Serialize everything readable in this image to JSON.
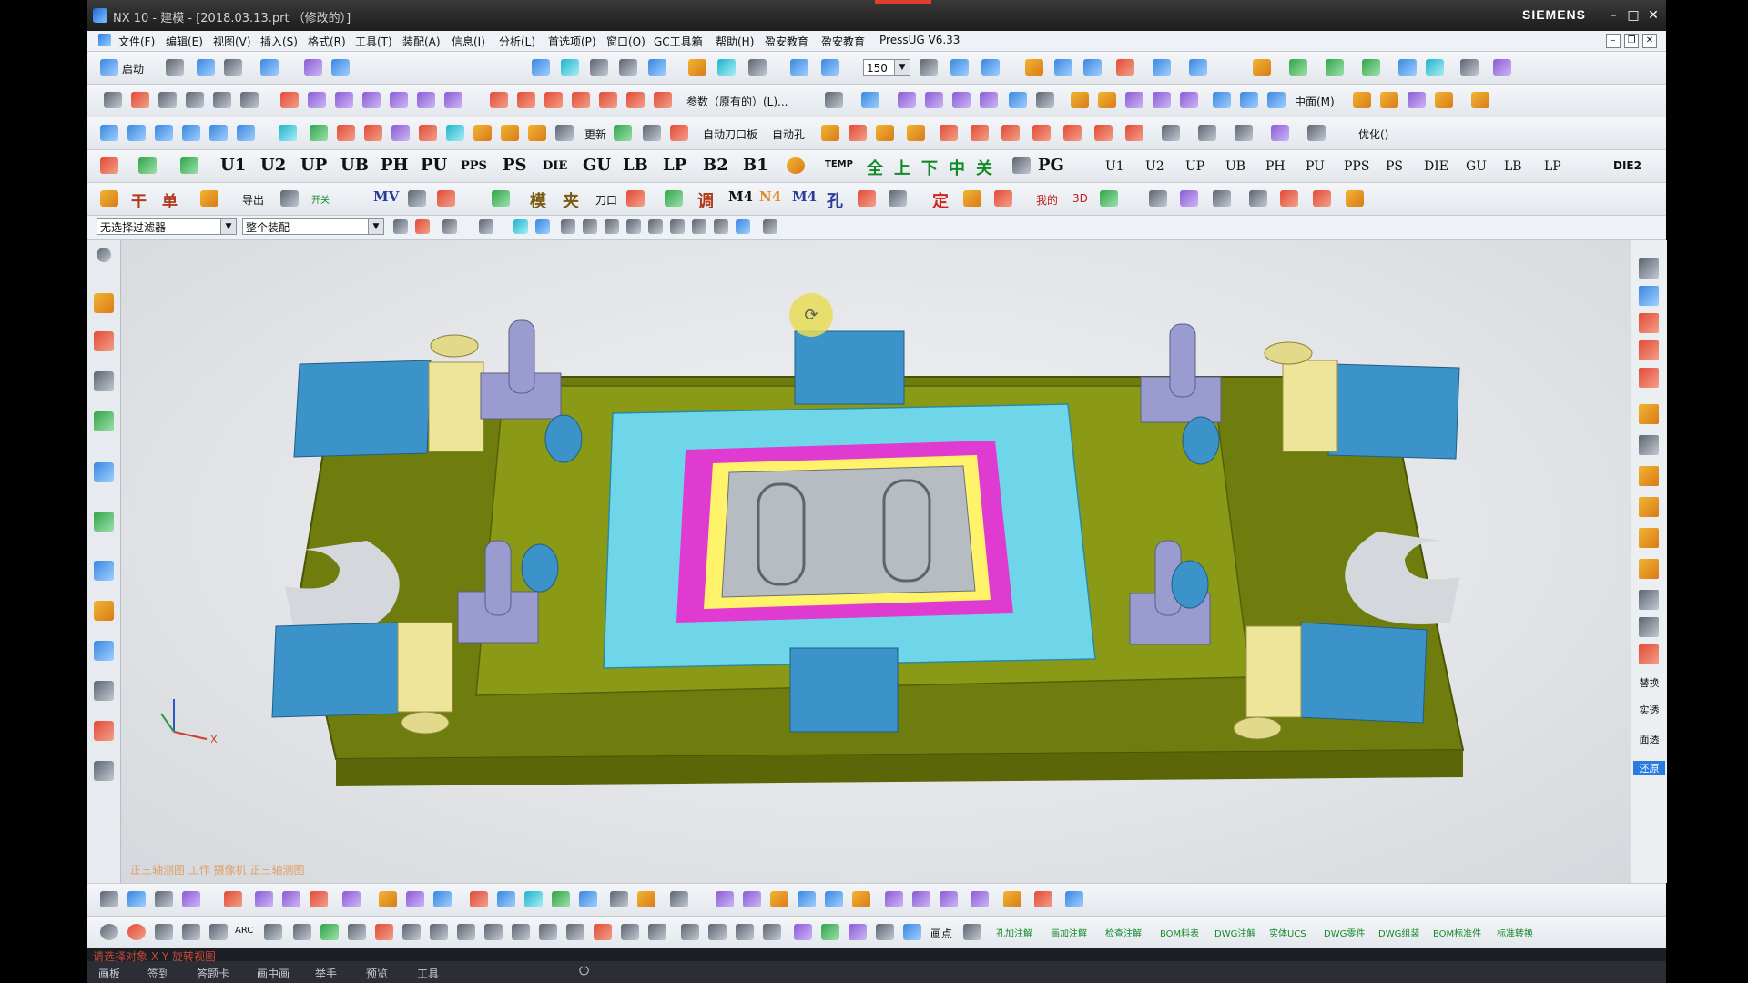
{
  "window": {
    "title": "NX 10 - 建模 - [2018.03.13.prt （修改的）]",
    "brand": "SIEMENS"
  },
  "menu": [
    "文件(F)",
    "编辑(E)",
    "视图(V)",
    "插入(S)",
    "格式(R)",
    "工具(T)",
    "装配(A)",
    "信息(I)",
    "分析(L)",
    "首选项(P)",
    "窗口(O)",
    "GC工具箱",
    "帮助(H)",
    "盈安教育",
    "盈安教育",
    "PressUG V6.33"
  ],
  "toolbar1": {
    "start_label": "启动",
    "zoom_value": "150"
  },
  "toolbar2": {
    "params_label": "参数（原有的）(L)...",
    "midplane_label": "中面(M)"
  },
  "toolbar3": {
    "auto_knife_label": "自动刀口板",
    "auto_hole_label": "自动孔",
    "optimize_label": "优化()",
    "update_label": "更新"
  },
  "toolbar4": {
    "left_codes": [
      "U1",
      "U2",
      "UP",
      "UB",
      "PH",
      "PU",
      "PPS",
      "PS",
      "DIE",
      "GU",
      "LB",
      "LP",
      "B2",
      "B1"
    ],
    "cjk_buttons": [
      "全",
      "上",
      "下",
      "中",
      "关"
    ],
    "right_codes": [
      "U1",
      "U2",
      "UP",
      "UB",
      "PH",
      "PU",
      "PPS",
      "PS",
      "DIE",
      "GU",
      "LB",
      "LP"
    ],
    "temp_label": "TEMP",
    "pg_label": "PG",
    "die2_label": "DIE2"
  },
  "toolbar5": {
    "labels": [
      "干",
      "单",
      "导出",
      "开关",
      "MV",
      "模",
      "夹",
      "刀口",
      "调",
      "M4",
      "N4",
      "M4",
      "孔",
      "定",
      "我的",
      "3D"
    ]
  },
  "filter": {
    "selection_filter": "无选择过滤器",
    "assembly_scope": "整个装配"
  },
  "viewport": {
    "hint": "正三轴测图 工作 摄像机 正三轴测图",
    "axis_x": "X"
  },
  "rightbar": {
    "labels": [
      "替换",
      "实透",
      "面透",
      "还原"
    ]
  },
  "bottom2": {
    "labels": [
      "ARC",
      "画点",
      "孔加注解",
      "画加注解",
      "检查注解",
      "BOM料表",
      "DWG注解",
      "实体UCS",
      "DWG零件",
      "DWG组装",
      "BOM标准件",
      "标准转换"
    ]
  },
  "cue": "请选择对象 X Y 旋转视图",
  "taskbar": [
    "画板",
    "签到",
    "答题卡",
    "画中画",
    "举手",
    "预览",
    "工具"
  ],
  "colors": {
    "plate_olive": "#7a8a12",
    "blue_block": "#3b93c9",
    "cyan_insert": "#6fd6ea",
    "yellow_block": "#efe59a",
    "magenta": "#e03bd0"
  }
}
